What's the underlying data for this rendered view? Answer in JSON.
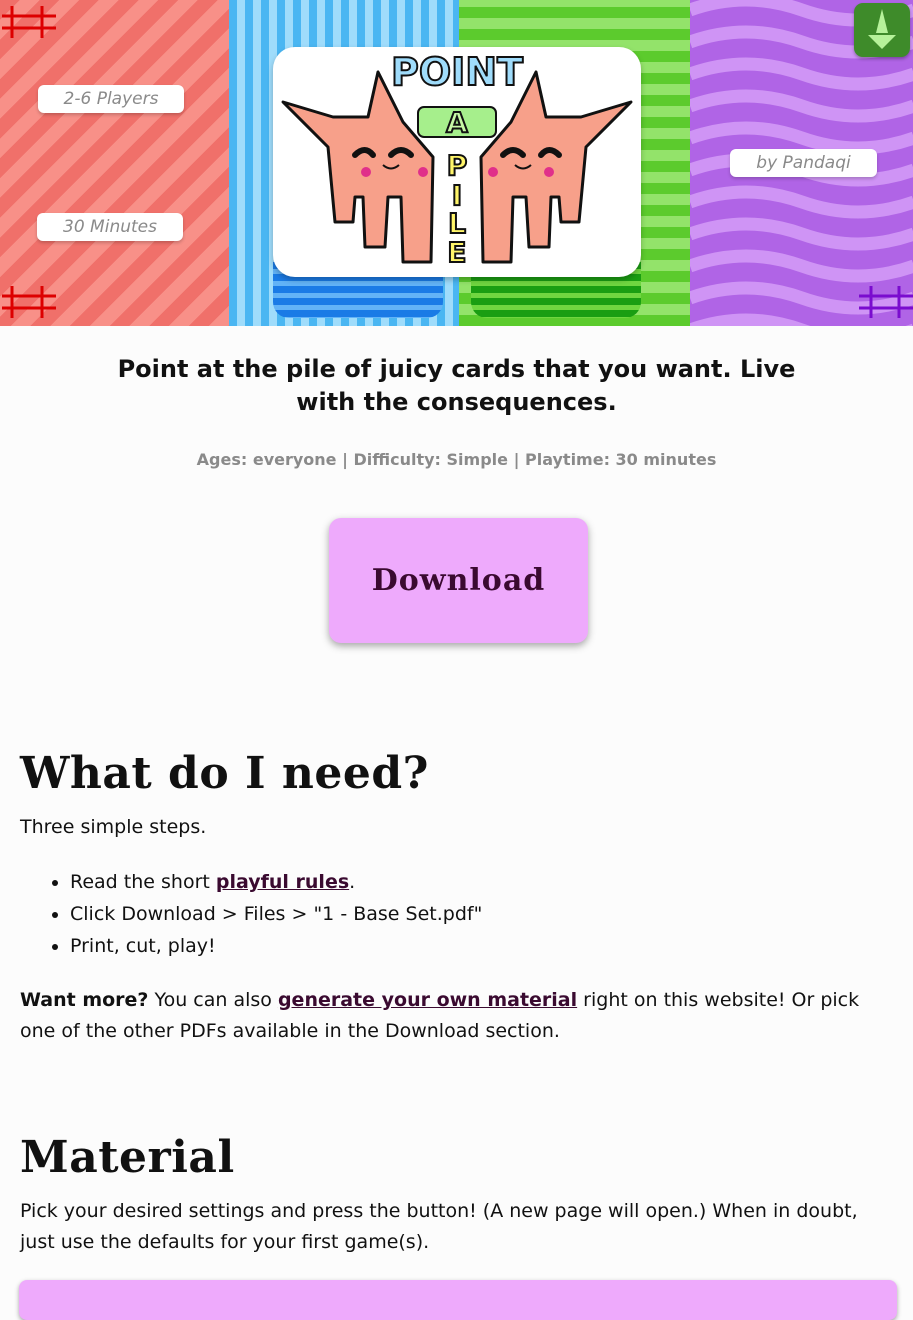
{
  "banner": {
    "players": "2-6 Players",
    "duration": "30 Minutes",
    "author": "by Pandaqi",
    "logo_word_1": "POINT",
    "logo_word_2": "A",
    "logo_word_3": "PILE"
  },
  "tagline": "Point at the pile of juicy cards that you want. Live with the consequences.",
  "meta": "Ages: everyone | Difficulty: Simple | Playtime: 30 minutes",
  "download_label": "Download",
  "need": {
    "heading": "What do I need?",
    "intro": "Three simple steps.",
    "step1_prefix": "Read the short ",
    "step1_link": "playful rules",
    "step1_suffix": ".",
    "step2": "Click Download > Files > \"1 - Base Set.pdf\"",
    "step3": "Print, cut, play!",
    "more_bold": "Want more?",
    "more_prefix": " You can also ",
    "more_link": "generate your own material",
    "more_suffix": " right on this website! Or pick one of the other PDFs available in the Download section."
  },
  "material": {
    "heading": "Material",
    "text": "Pick your desired settings and press the button! (A new page will open.) When in doubt, just use the defaults for your first game(s)."
  }
}
